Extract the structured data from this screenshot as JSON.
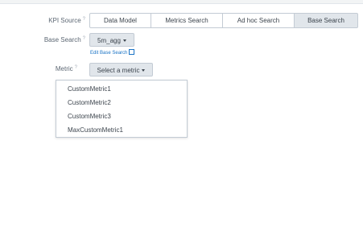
{
  "form": {
    "kpi_source": {
      "label": "KPI Source",
      "required_mark": "?",
      "options": [
        "Data Model",
        "Metrics Search",
        "Ad hoc Search",
        "Base Search"
      ],
      "selected": "Base Search"
    },
    "base_search": {
      "label": "Base Search",
      "required_mark": "?",
      "value": "5m_agg",
      "edit_link": "Edit Base Search"
    },
    "metric": {
      "label": "Metric",
      "required_mark": "?",
      "placeholder": "Select a metric",
      "options": [
        "CustomMetric1",
        "CustomMetric2",
        "CustomMetric3",
        "MaxCustomMetric1"
      ]
    }
  },
  "colors": {
    "link": "#1a73c5",
    "active_segment": "#e1e6eb",
    "border": "#c3cbd4"
  },
  "icons": [
    "caret-down-icon",
    "external-link-icon",
    "required-marker-icon"
  ]
}
